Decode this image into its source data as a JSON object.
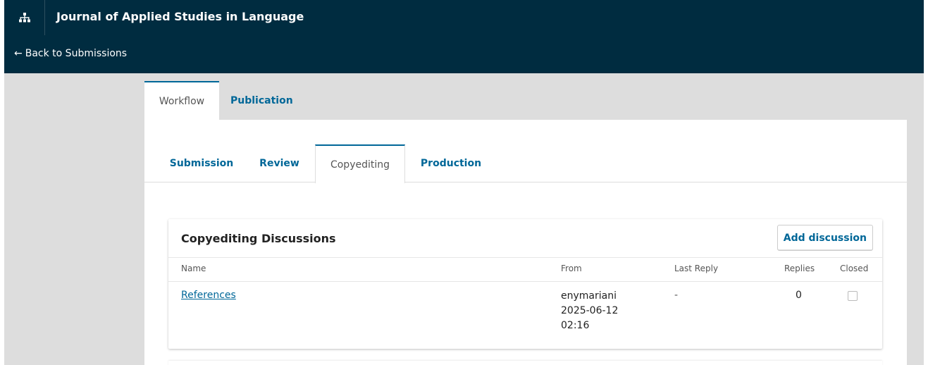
{
  "header": {
    "journal_title": "Journal of Applied Studies in Language",
    "sitemap_icon": "sitemap-icon",
    "back_arrow": "←",
    "back_label": "Back to Submissions"
  },
  "main_tabs": [
    {
      "label": "Workflow",
      "active": true
    },
    {
      "label": "Publication",
      "active": false
    }
  ],
  "sub_tabs": [
    {
      "label": "Submission",
      "active": false
    },
    {
      "label": "Review",
      "active": false
    },
    {
      "label": "Copyediting",
      "active": true
    },
    {
      "label": "Production",
      "active": false
    }
  ],
  "discussions": {
    "title": "Copyediting Discussions",
    "add_button": "Add discussion",
    "columns": {
      "name": "Name",
      "from": "From",
      "last_reply": "Last Reply",
      "replies": "Replies",
      "closed": "Closed"
    },
    "rows": [
      {
        "name": "References",
        "from_user": "enymariani",
        "from_date": "2025-06-12",
        "from_time": "02:16",
        "last_reply": "-",
        "replies": "0",
        "closed": false
      }
    ]
  },
  "colors": {
    "header_bg": "#002c40",
    "accent": "#006798",
    "page_bg": "#dddddd"
  }
}
